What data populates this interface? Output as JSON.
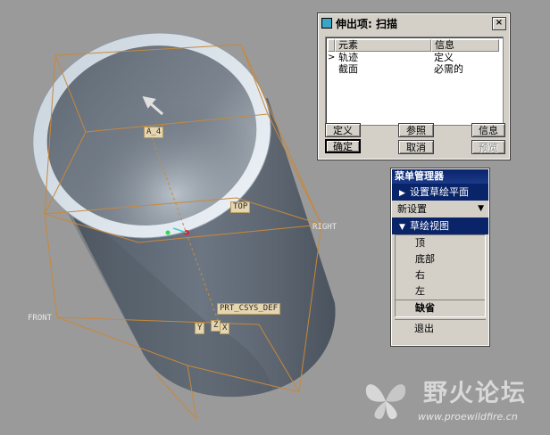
{
  "viewport": {
    "datum_labels": {
      "axis": "A_4",
      "top": "TOP",
      "right": "RIGHT",
      "front": "FRONT",
      "csys": "PRT_CSYS_DEF",
      "csys_y": "Y",
      "csys_z": "Z",
      "csys_x": "X"
    }
  },
  "sweep_dialog": {
    "title": "伸出项: 扫描",
    "close_label": "×",
    "columns": [
      "元素",
      "信息"
    ],
    "rows": [
      {
        "marker": ">",
        "element": "轨迹",
        "info": "定义"
      },
      {
        "marker": "",
        "element": "截面",
        "info": "必需的"
      }
    ],
    "buttons": {
      "define": "定义",
      "reference": "参照",
      "info": "信息",
      "ok": "确定",
      "cancel": "取消",
      "preview": "预览"
    }
  },
  "menu_manager": {
    "title": "菜单管理器",
    "set_sketch_plane": "设置草绘平面",
    "new_settings": "新设置",
    "sketch_view": "草绘视图",
    "options": [
      "顶",
      "底部",
      "右",
      "左"
    ],
    "default": "缺省",
    "exit": "退出"
  },
  "watermark": {
    "name": "野火论坛",
    "url": "www.proewildfire.cn"
  },
  "colors": {
    "background": "#9a9a9a",
    "model": "#5b6570",
    "datum": "#c8883a",
    "menu_highlight": "#0a246a"
  }
}
